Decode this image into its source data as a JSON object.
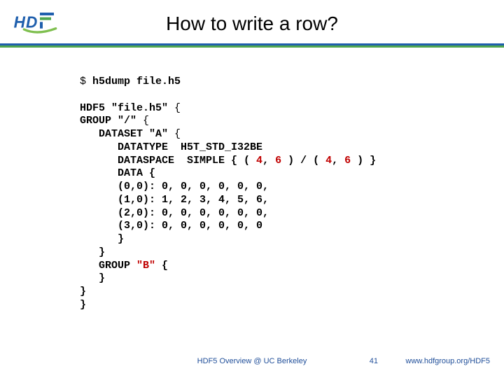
{
  "title": "How to write a row?",
  "logo": {
    "text": "HDF",
    "colors": {
      "h": "#1f5fad",
      "bar1": "#1f5fad",
      "bar2": "#4fa64f",
      "bar3": "#7fbf4f"
    }
  },
  "code": {
    "cmd_prompt": "$ ",
    "cmd": "h5dump file.h5",
    "l1_a": "HDF5 \"file.h5\"",
    "l1_b": " {",
    "l2_a": "GROUP ",
    "l2_b": "\"/\"",
    "l2_c": " {",
    "l3_a": "   DATASET ",
    "l3_b": "\"A\"",
    "l3_c": " {",
    "l4": "      DATATYPE  H5T_STD_I32BE",
    "l5_a": "      DATASPACE  SIMPLE { ( ",
    "l5_b": "4",
    "l5_c": ", ",
    "l5_d": "6",
    "l5_e": " ) / ( ",
    "l5_f": "4",
    "l5_g": ", ",
    "l5_h": "6",
    "l5_i": " ) }",
    "l6": "      DATA {",
    "l7": "      (0,0): 0, 0, 0, 0, 0, 0,",
    "l8": "      (1,0): 1, 2, 3, 4, 5, 6,",
    "l9": "      (2,0): 0, 0, 0, 0, 0, 0,",
    "l10": "      (3,0): 0, 0, 0, 0, 0, 0",
    "l11": "      }",
    "l12": "   }",
    "l13_a": "   GROUP ",
    "l13_b": "\"B\"",
    "l13_c": " {",
    "l14": "   }",
    "l15": "}",
    "l16": "}"
  },
  "footer": {
    "center": "HDF5 Overview @ UC Berkeley",
    "page": "41",
    "url": "www.hdfgroup.org/HDF5"
  }
}
